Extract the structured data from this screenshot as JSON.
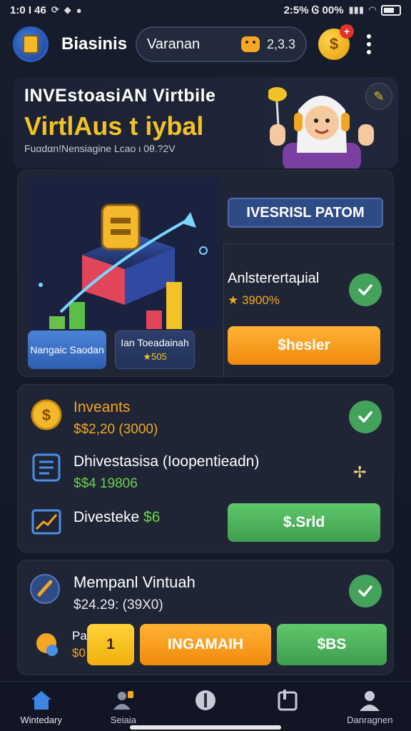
{
  "status": {
    "time": "1:0 Ɩ 46",
    "right_text": "2:5% Ꮆ 00%"
  },
  "header": {
    "app_title": "Biasinis",
    "search_label": "Varanan",
    "search_value": "2,3.3",
    "coin_symbol": "$",
    "notification_badge": "+"
  },
  "hero": {
    "title_line1": "INVEstoasiAN Virtbile",
    "title_line2": "VirtlAus t iybal",
    "subtitle": "Fuαdαn!Nensiagine Lcao ι 0θ.?2V"
  },
  "card1": {
    "chip1_label": "Nangaic Saodan",
    "chip2_label": "Ian Toeadainah",
    "chip2_rating": "★505",
    "platform_button": "IVESRISL PATOM",
    "title": "Anlsterertaμial",
    "rating": "★ 3900%",
    "action_button": "$hesler"
  },
  "card2": {
    "row1_title": "Inveants",
    "row1_value": "$$2,20 (3000)",
    "row2_title": "Dhivestasisa (Ioopentieadn)",
    "row2_value": "$$4 19806",
    "row3_title": "Divesteke",
    "row3_value": "$6",
    "action_button": "$.Srld"
  },
  "card3": {
    "title": "Mempanl Vintuah",
    "value": "$24.29: (39X0)",
    "partial_label": "Pa",
    "partial_value": "$0",
    "small_button": "1",
    "orange_button": "INGAMAIH",
    "green_button": "$BS"
  },
  "tabs": [
    {
      "label": "Wintedary",
      "icon": "home-icon"
    },
    {
      "label": "Seiaia",
      "icon": "user-group-icon"
    },
    {
      "label": "",
      "icon": "circle-info-icon"
    },
    {
      "label": "",
      "icon": "document-icon"
    },
    {
      "label": "Danragnen",
      "icon": "profile-icon"
    }
  ],
  "colors": {
    "accent_yellow": "#f3c226",
    "accent_orange": "#f18a0e",
    "accent_green": "#43a35a",
    "card_bg": "#1f2535"
  }
}
